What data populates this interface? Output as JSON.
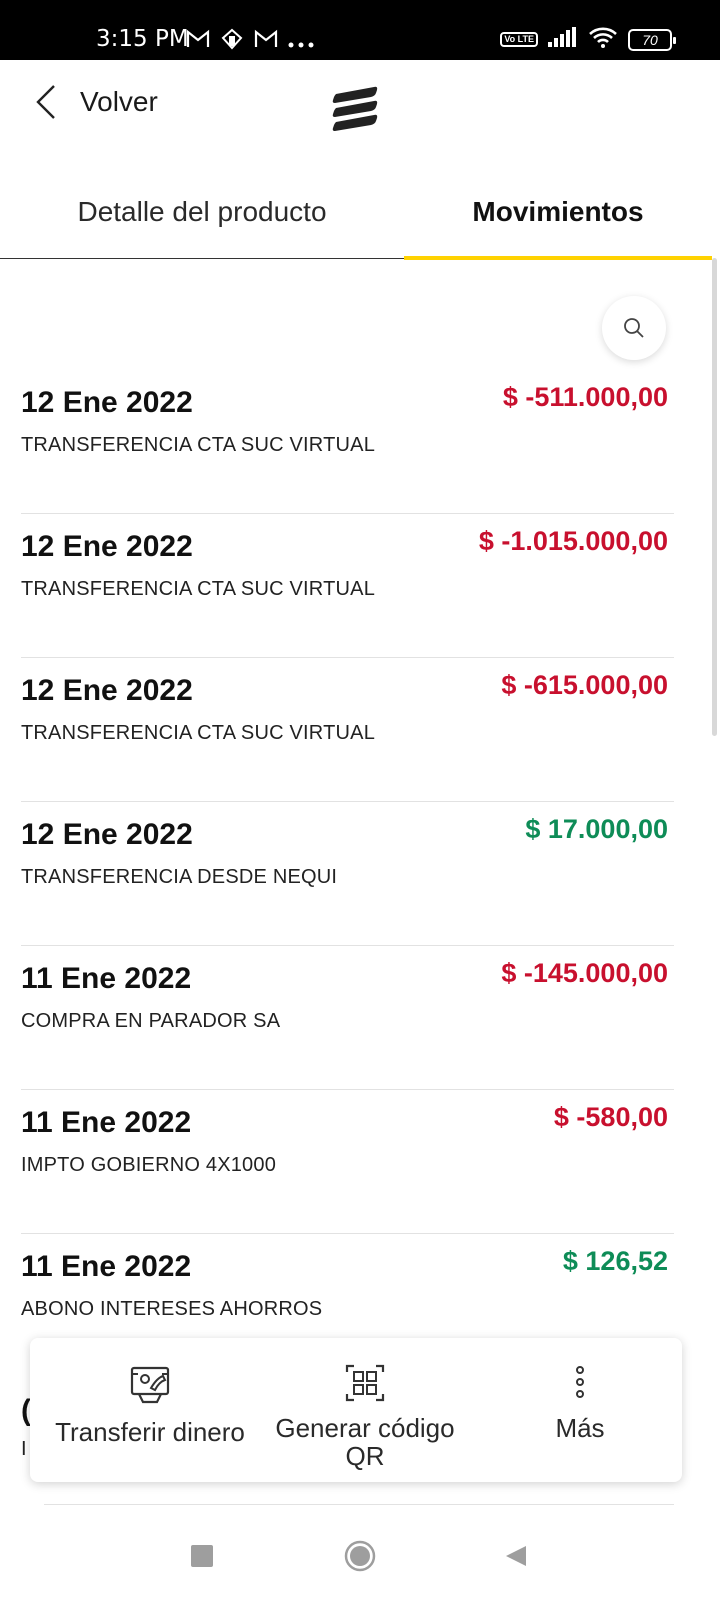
{
  "status_bar": {
    "time": "3:15 PM",
    "left_icons": [
      "gmail-icon",
      "vpn-icon",
      "gmail-icon",
      "more-dots-icon"
    ],
    "volte_label": "Vo LTE",
    "battery_level": "70"
  },
  "header": {
    "back_label": "Volver",
    "logo_icon": "bank-logo-icon"
  },
  "tabs": [
    {
      "label": "Detalle del producto",
      "active": false
    },
    {
      "label": "Movimientos",
      "active": true
    }
  ],
  "colors": {
    "accent_yellow": "#ffd200",
    "negative_amount": "#c8102e",
    "positive_amount": "#0e8c57"
  },
  "movements": [
    {
      "date": "12 Ene 2022",
      "description": "TRANSFERENCIA CTA SUC VIRTUAL",
      "amount": "$ -511.000,00",
      "type": "negative"
    },
    {
      "date": "12 Ene 2022",
      "description": "TRANSFERENCIA CTA SUC VIRTUAL",
      "amount": "$ -1.015.000,00",
      "type": "negative"
    },
    {
      "date": "12 Ene 2022",
      "description": "TRANSFERENCIA CTA SUC VIRTUAL",
      "amount": "$ -615.000,00",
      "type": "negative"
    },
    {
      "date": "12 Ene 2022",
      "description": "TRANSFERENCIA DESDE NEQUI",
      "amount": "$ 17.000,00",
      "type": "positive"
    },
    {
      "date": "11 Ene 2022",
      "description": "COMPRA EN  PARADOR SA",
      "amount": "$ -145.000,00",
      "type": "negative"
    },
    {
      "date": "11 Ene 2022",
      "description": "IMPTO GOBIERNO 4X1000",
      "amount": "$ -580,00",
      "type": "negative"
    },
    {
      "date": "11 Ene 2022",
      "description": "ABONO INTERESES AHORROS",
      "amount": "$ 126,52",
      "type": "positive"
    }
  ],
  "partial_row": {
    "date_fragment": "(",
    "desc_fragment": "I"
  },
  "actions": [
    {
      "label": "Transferir dinero",
      "icon": "transfer-money-icon"
    },
    {
      "label": "Generar código QR",
      "icon": "qr-code-icon"
    },
    {
      "label": "Más",
      "icon": "more-vertical-icon"
    }
  ]
}
